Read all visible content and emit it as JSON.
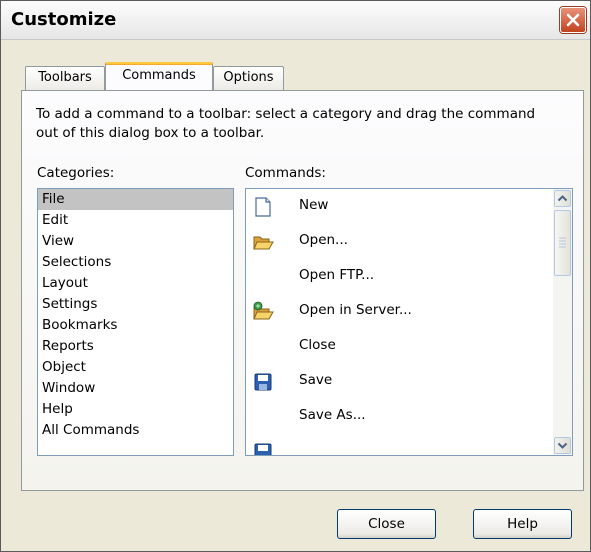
{
  "window": {
    "title": "Customize"
  },
  "tabs": [
    {
      "label": "Toolbars",
      "active": false
    },
    {
      "label": "Commands",
      "active": true
    },
    {
      "label": "Options",
      "active": false
    }
  ],
  "instructions": "To add a command to a toolbar: select a category and drag the command out of this dialog box to a toolbar.",
  "categories": {
    "label": "Categories:",
    "selected": "File",
    "items": [
      "File",
      "Edit",
      "View",
      "Selections",
      "Layout",
      "Settings",
      "Bookmarks",
      "Reports",
      "Object",
      "Window",
      "Help",
      "All Commands"
    ]
  },
  "commands": {
    "label": "Commands:",
    "items": [
      {
        "label": "New",
        "icon": "new-document-icon"
      },
      {
        "label": "Open...",
        "icon": "open-folder-icon"
      },
      {
        "label": "Open FTP...",
        "icon": ""
      },
      {
        "label": "Open in Server...",
        "icon": "open-in-server-icon"
      },
      {
        "label": "Close",
        "icon": ""
      },
      {
        "label": "Save",
        "icon": "save-disk-icon"
      },
      {
        "label": "Save As...",
        "icon": ""
      }
    ]
  },
  "buttons": {
    "close": "Close",
    "help": "Help"
  }
}
